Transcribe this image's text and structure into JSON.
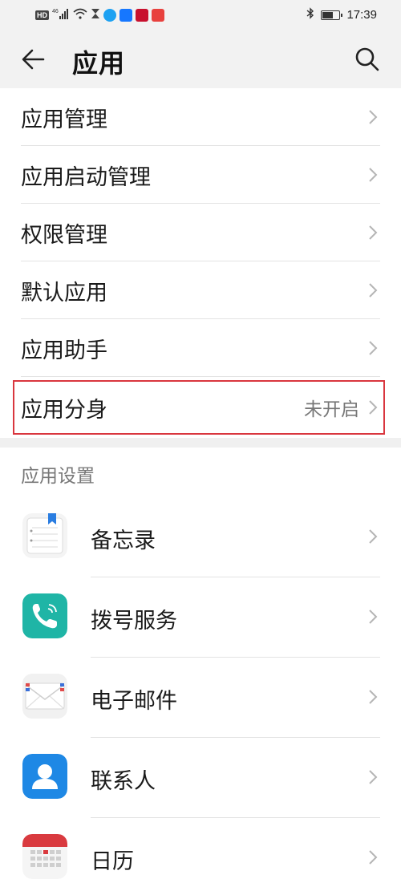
{
  "status_bar": {
    "network": "46",
    "hd_label": "HD",
    "time": "17:39"
  },
  "header": {
    "title": "应用"
  },
  "main_list": [
    {
      "label": "应用管理"
    },
    {
      "label": "应用启动管理"
    },
    {
      "label": "权限管理"
    },
    {
      "label": "默认应用"
    },
    {
      "label": "应用助手"
    },
    {
      "label": "应用分身",
      "value": "未开启"
    }
  ],
  "app_settings": {
    "section_title": "应用设置",
    "items": [
      {
        "label": "备忘录",
        "icon": "memo-icon"
      },
      {
        "label": "拨号服务",
        "icon": "phone-icon"
      },
      {
        "label": "电子邮件",
        "icon": "email-icon"
      },
      {
        "label": "联系人",
        "icon": "contacts-icon"
      },
      {
        "label": "日历",
        "icon": "calendar-icon"
      }
    ]
  },
  "colors": {
    "highlight_border": "#d9363e",
    "phone_teal": "#1fb5a6",
    "contacts_blue": "#1e88e5",
    "calendar_red": "#d93a3f"
  }
}
